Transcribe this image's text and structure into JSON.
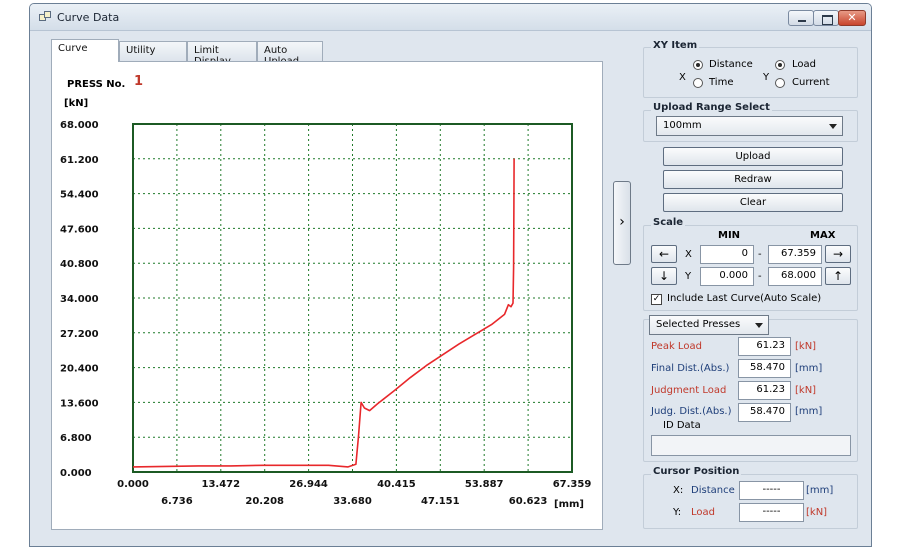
{
  "window": {
    "title": "Curve Data",
    "controls": {
      "close": "✕"
    }
  },
  "tabs": [
    {
      "label": "Curve",
      "active": true
    },
    {
      "label": "Utility",
      "active": false
    },
    {
      "label": "Limit Display",
      "active": false
    },
    {
      "label": "Auto Upload",
      "active": false
    }
  ],
  "curve": {
    "press_label": "PRESS No.",
    "press_number": "1",
    "y_unit": "[kN]",
    "x_unit": "[mm]"
  },
  "chart_data": {
    "type": "line",
    "xlim": [
      0,
      67.359
    ],
    "ylim": [
      0,
      68.0
    ],
    "y_ticks": [
      "0.000",
      "6.800",
      "13.600",
      "20.400",
      "27.200",
      "34.000",
      "40.800",
      "47.600",
      "54.400",
      "61.200",
      "68.000"
    ],
    "x_ticks_top": [
      "0.000",
      "13.472",
      "26.944",
      "40.415",
      "53.887",
      "67.359"
    ],
    "x_ticks_bottom": [
      "6.736",
      "20.208",
      "33.680",
      "47.151",
      "60.623"
    ],
    "grid": true,
    "series": [
      {
        "color": "#e8282b",
        "x": [
          0,
          5,
          10,
          15,
          20,
          25,
          30,
          33.0,
          34.2,
          34.6,
          35.0,
          35.5,
          36.3,
          37.5,
          40.0,
          42.5,
          45.0,
          47.5,
          50.0,
          52.5,
          55.0,
          57.0,
          57.6,
          58.0,
          58.3,
          58.4,
          58.45,
          58.47
        ],
        "y": [
          1.0,
          1.1,
          1.2,
          1.2,
          1.3,
          1.3,
          1.3,
          1.0,
          1.5,
          7.0,
          13.6,
          12.5,
          12.0,
          13.3,
          15.8,
          18.4,
          20.8,
          22.9,
          25.0,
          26.9,
          28.8,
          30.8,
          32.7,
          32.3,
          33.0,
          40.0,
          52.0,
          61.23
        ]
      }
    ]
  },
  "xy_item": {
    "title": "XY Item",
    "x_label": "X",
    "y_label": "Y",
    "x_options": [
      {
        "label": "Distance",
        "selected": true
      },
      {
        "label": "Time",
        "selected": false
      }
    ],
    "y_options": [
      {
        "label": "Load",
        "selected": true
      },
      {
        "label": "Current",
        "selected": false
      }
    ]
  },
  "upload_range": {
    "title": "Upload Range Select",
    "selected": "100mm"
  },
  "buttons": {
    "upload": "Upload",
    "redraw": "Redraw",
    "clear": "Clear"
  },
  "scale": {
    "title": "Scale",
    "min_label": "MIN",
    "max_label": "MAX",
    "x_label": "X",
    "y_label": "Y",
    "separator": "-",
    "x_min": "0",
    "x_max": "67.359",
    "y_min": "0.000",
    "y_max": "68.000",
    "arrows": {
      "left": "←",
      "right": "→",
      "down": "↓",
      "up": "↑"
    },
    "include_last": "Include Last Curve(Auto Scale)",
    "include_last_checked": true,
    "check_mark": "✓"
  },
  "results": {
    "selector": "Selected Presses",
    "rows": [
      {
        "label": "Peak Load",
        "value": "61.23",
        "unit": "[kN]",
        "color": "#c0392b"
      },
      {
        "label": "Final Dist.(Abs.)",
        "value": "58.470",
        "unit": "[mm]",
        "color": "#1f3f7a"
      },
      {
        "label": "Judgment Load",
        "value": "61.23",
        "unit": "[kN]",
        "color": "#c0392b"
      },
      {
        "label": "Judg. Dist.(Abs.)",
        "value": "58.470",
        "unit": "[mm]",
        "color": "#1f3f7a"
      }
    ],
    "id_label": "ID Data",
    "id_value": ""
  },
  "cursor": {
    "title": "Cursor Position",
    "x_axis": "X:",
    "x_name": "Distance",
    "x_value": "-----",
    "x_unit": "[mm]",
    "y_axis": "Y:",
    "y_name": "Load",
    "y_value": "-----",
    "y_unit": "[kN]"
  },
  "panel_toggle": "›"
}
